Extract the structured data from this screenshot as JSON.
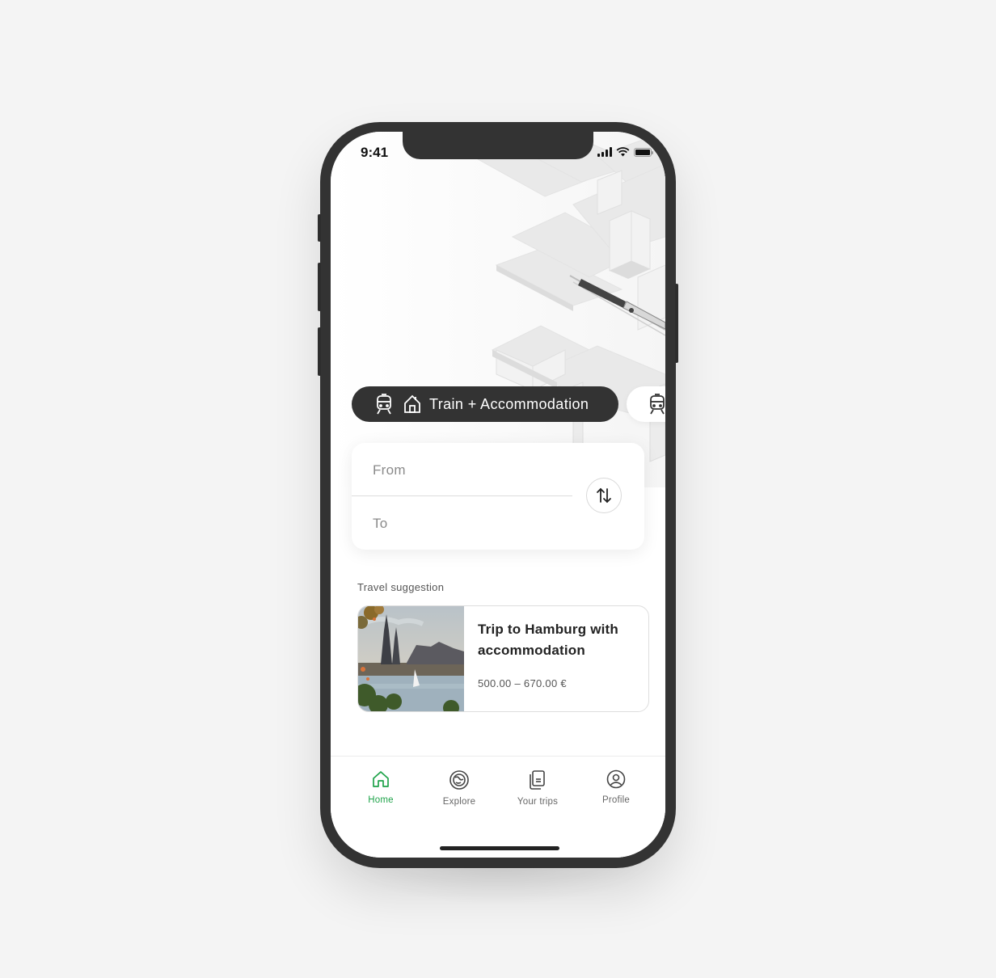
{
  "status_bar": {
    "time": "9:41"
  },
  "mode_selector": {
    "active_label": "Train + Accommodation",
    "active_icons": [
      "train-icon",
      "house-icon"
    ],
    "next_icons": [
      "train-icon"
    ]
  },
  "search": {
    "from_placeholder": "From",
    "to_placeholder": "To",
    "swap_icon": "swap-vertical-icon"
  },
  "suggestions": {
    "title": "Travel suggestion",
    "items": [
      {
        "title": "Trip to Hamburg with accommodation",
        "price": "500.00 – 670.00 €"
      }
    ]
  },
  "tabbar": {
    "items": [
      {
        "label": "Home",
        "icon": "home-icon",
        "active": true
      },
      {
        "label": "Explore",
        "icon": "globe-icon",
        "active": false
      },
      {
        "label": "Your trips",
        "icon": "ticket-icon",
        "active": false
      },
      {
        "label": "Profile",
        "icon": "profile-icon",
        "active": false
      }
    ]
  },
  "colors": {
    "accent": "#1fa34a",
    "dark": "#333333",
    "background": "#f4f4f4"
  }
}
